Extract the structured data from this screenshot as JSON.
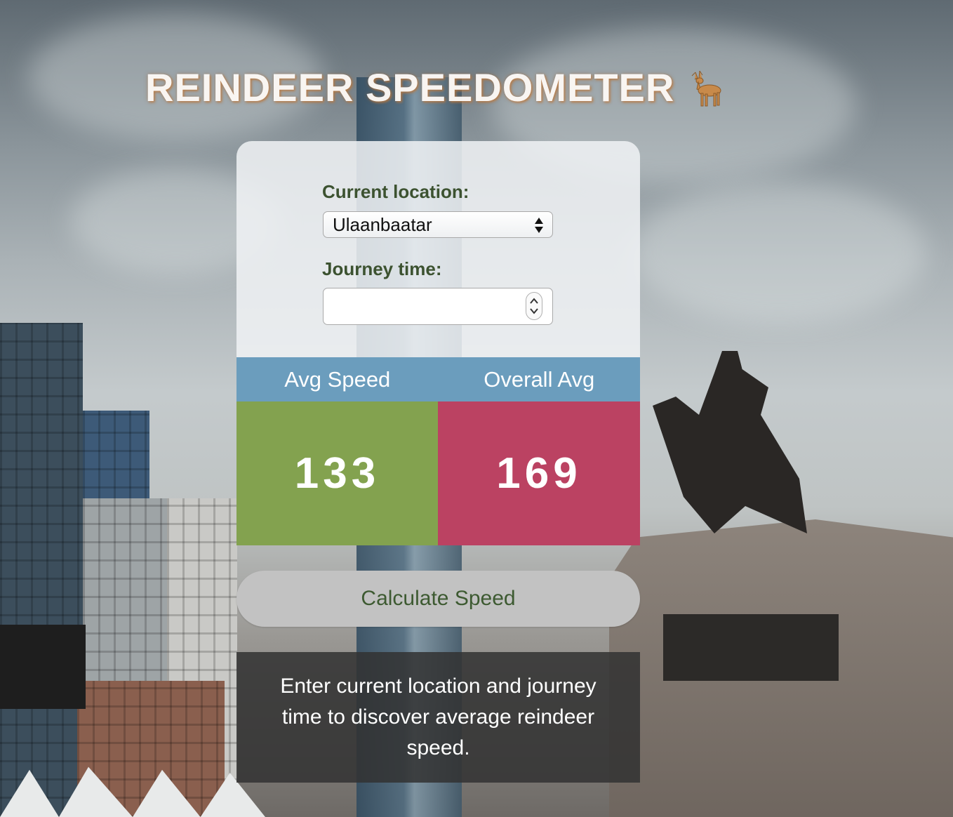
{
  "app": {
    "title": "REINDEER SPEEDOMETER",
    "title_icon": "deer-icon"
  },
  "form": {
    "location_label": "Current location:",
    "location_value": "Ulaanbaatar",
    "journey_label": "Journey time:",
    "journey_value": ""
  },
  "stats": {
    "avg_speed_label": "Avg Speed",
    "overall_avg_label": "Overall Avg",
    "avg_speed_value": "133",
    "overall_avg_value": "169"
  },
  "actions": {
    "calculate_label": "Calculate Speed"
  },
  "message": {
    "text": "Enter current location and journey time to discover average reindeer speed."
  },
  "colors": {
    "header_blue": "#6b9dbd",
    "avg_green": "#83a24f",
    "overall_red": "#bb4262",
    "label_green": "#3c5230"
  }
}
